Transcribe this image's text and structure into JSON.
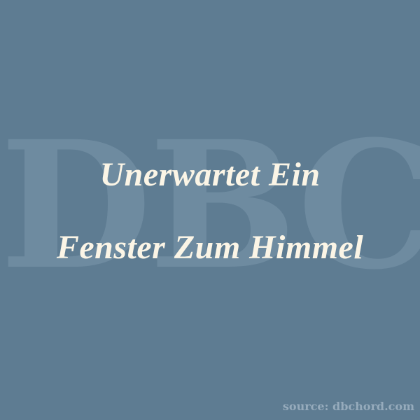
{
  "watermark": {
    "text": "DBC"
  },
  "title": {
    "line1": "Unerwartet Ein",
    "line2": "Fenster Zum Himmel"
  },
  "source": {
    "text": "source: dbchord.com"
  },
  "colors": {
    "background": "#5e7c92",
    "title_text": "#fbf5e6",
    "watermark": "#7490a5",
    "source_text": "#96abbc"
  }
}
